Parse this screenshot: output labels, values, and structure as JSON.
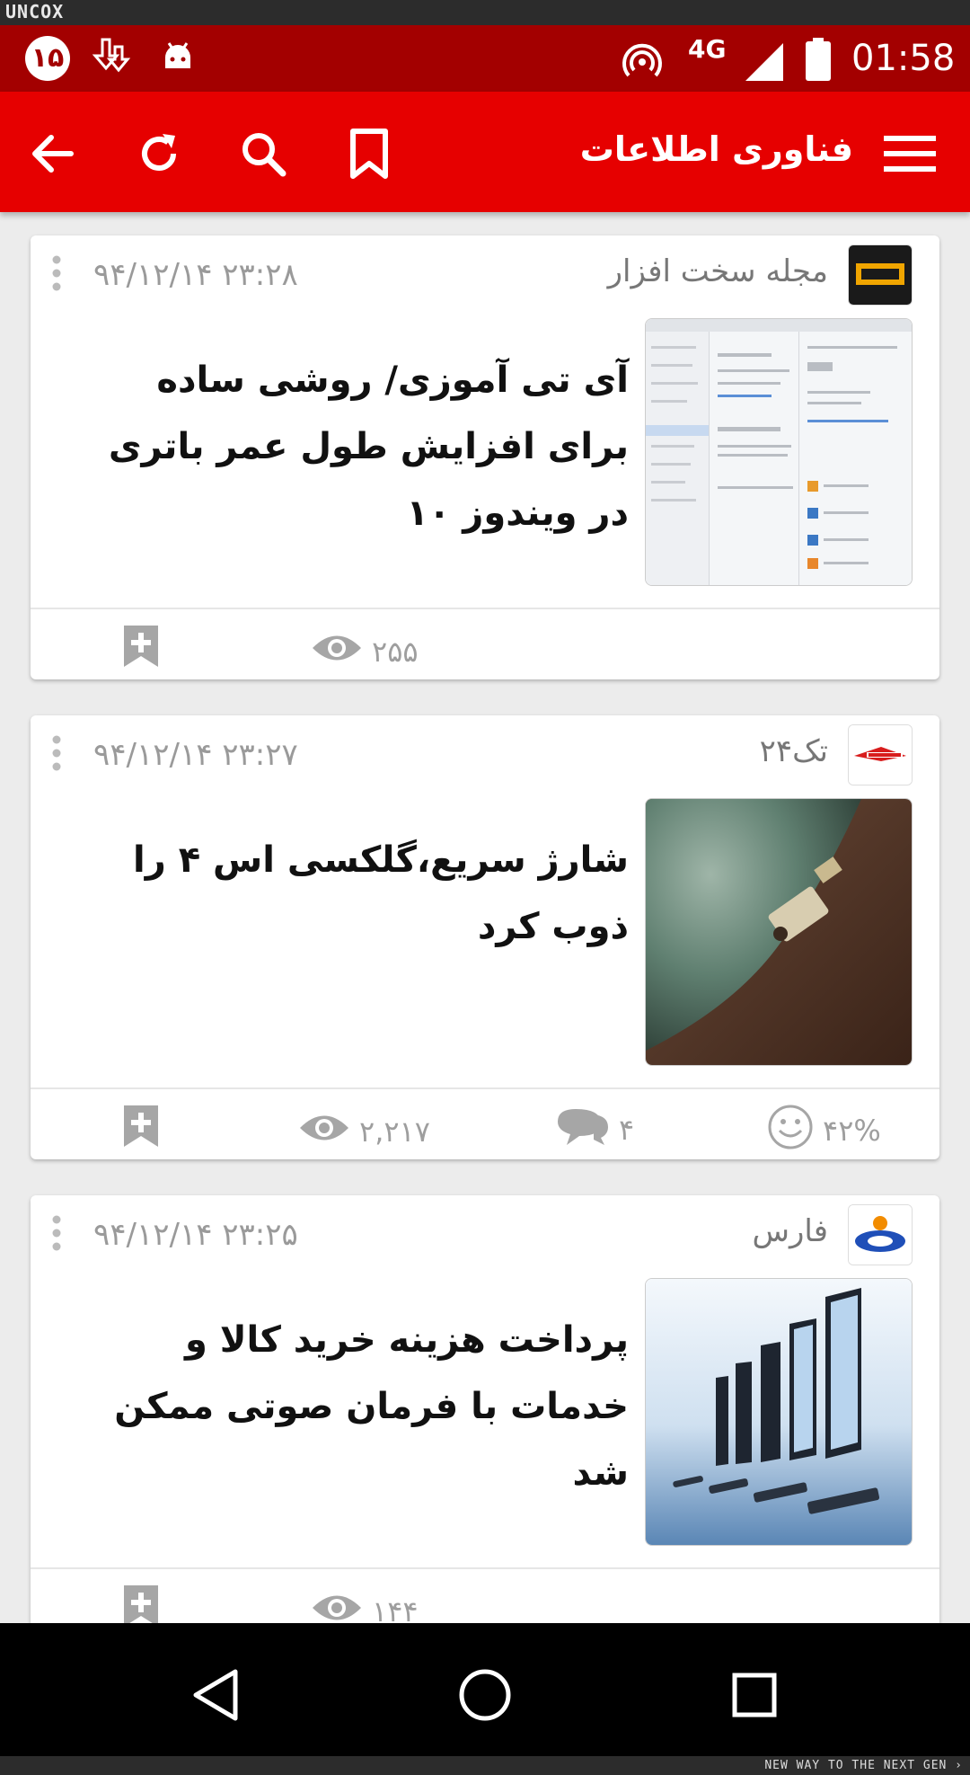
{
  "frame": {
    "top_brand": "UNCOX",
    "bottom_tagline": "NEW WAY TO THE NEXT GEN ›"
  },
  "status_bar": {
    "notification_count": "۱۵",
    "network": "4G",
    "time": "01:58",
    "icons": [
      "download-icon",
      "android-icon",
      "hotspot-icon",
      "signal-icon",
      "battery-icon"
    ]
  },
  "app_bar": {
    "title": "فناوری اطلاعات",
    "icons": [
      "back-arrow-icon",
      "refresh-icon",
      "search-icon",
      "bookmark-icon",
      "hamburger-menu-icon"
    ]
  },
  "cards": [
    {
      "source": "مجله سخت افزار",
      "time": "۹۴/۱۲/۱۴  ۲۳:۲۸",
      "title": "آی تی آموزی/ روشی ساده برای افزایش طول عمر باتری در ویندوز ۱۰",
      "views": "۲۵۵"
    },
    {
      "source": "تک۲۴",
      "time": "۹۴/۱۲/۱۴  ۲۳:۲۷",
      "title": "شارژ سریع،گلکسی اس ۴ را ذوب کرد",
      "views": "۲,۲۱۷",
      "comments": "۴",
      "rating": "۴۲%"
    },
    {
      "source": "فارس",
      "time": "۹۴/۱۲/۱۴  ۲۳:۲۵",
      "title": "پرداخت هزینه خرید کالا و خدمات با فرمان صوتی ممکن شد",
      "views": "۱۴۴"
    }
  ],
  "colors": {
    "status_bar": "#a30000",
    "app_bar": "#e60000",
    "background": "#ececec"
  }
}
